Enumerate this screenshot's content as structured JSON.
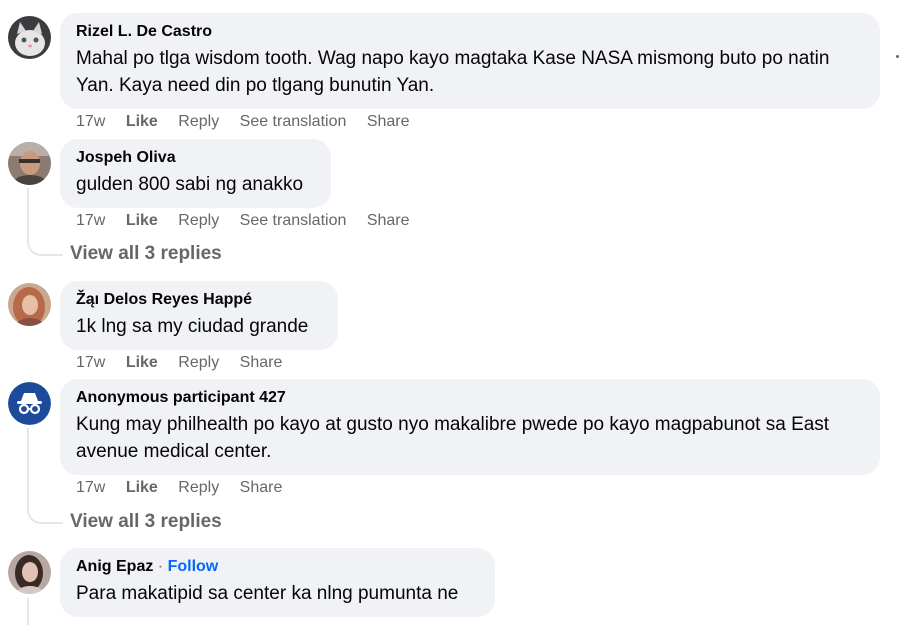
{
  "comments": [
    {
      "author": "Rizel L. De Castro",
      "text": "Mahal po tlga wisdom tooth. Wag napo kayo magtaka Kase NASA mismong buto po natin Yan. Kaya need din po tlgang bunutin Yan.",
      "time": "17w",
      "like": "Like",
      "reply": "Reply",
      "see_translation": "See translation",
      "share": "Share",
      "avatar_icon": "cat-photo-avatar"
    },
    {
      "author": "Jospeh Oliva",
      "text": "gulden 800 sabi ng anakko",
      "time": "17w",
      "like": "Like",
      "reply": "Reply",
      "see_translation": "See translation",
      "share": "Share",
      "view_replies": "View all 3 replies",
      "avatar_icon": "person-photo-avatar"
    },
    {
      "author": "Žąı Delos Reyes Happé",
      "text": "1k lng sa my ciudad grande",
      "time": "17w",
      "like": "Like",
      "reply": "Reply",
      "share": "Share",
      "avatar_icon": "person-photo-avatar"
    },
    {
      "author": "Anonymous participant 427",
      "text": "Kung may philhealth po kayo at gusto nyo makalibre pwede po kayo magpabunot sa East avenue medical center.",
      "time": "17w",
      "like": "Like",
      "reply": "Reply",
      "share": "Share",
      "view_replies": "View all 3 replies",
      "avatar_icon": "anonymous-spy-avatar"
    },
    {
      "author": "Anig Epaz",
      "follow_separator": "·",
      "follow": "Follow",
      "text": "Para makatipid sa center ka nlng pumunta ne",
      "avatar_icon": "person-photo-avatar"
    }
  ],
  "colors": {
    "bubble": "#f0f2f5",
    "secondary_text": "#65676b",
    "link_blue": "#0866ff",
    "anonymous_avatar": "#1c4b9c"
  }
}
